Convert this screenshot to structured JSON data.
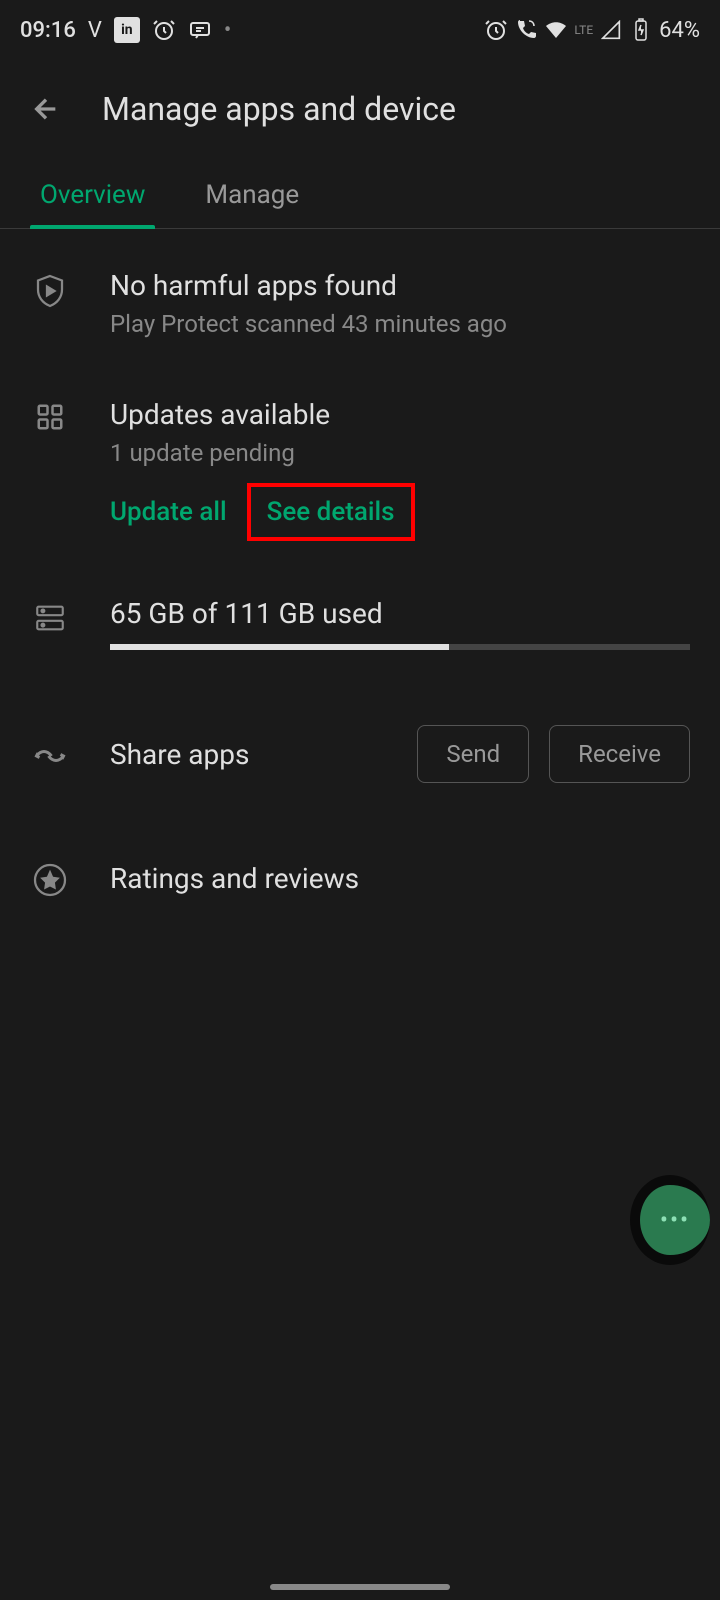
{
  "status_bar": {
    "time": "09:16",
    "v_indicator": "V",
    "lte": "LTE",
    "battery": "64%"
  },
  "header": {
    "title": "Manage apps and device"
  },
  "tabs": {
    "overview": "Overview",
    "manage": "Manage"
  },
  "play_protect": {
    "title": "No harmful apps found",
    "subtitle": "Play Protect scanned 43 minutes ago"
  },
  "updates": {
    "title": "Updates available",
    "subtitle": "1 update pending",
    "update_all": "Update all",
    "see_details": "See details"
  },
  "storage": {
    "text": "65 GB of 111 GB used",
    "used_gb": 65,
    "total_gb": 111
  },
  "share": {
    "label": "Share apps",
    "send": "Send",
    "receive": "Receive"
  },
  "ratings": {
    "label": "Ratings and reviews"
  }
}
